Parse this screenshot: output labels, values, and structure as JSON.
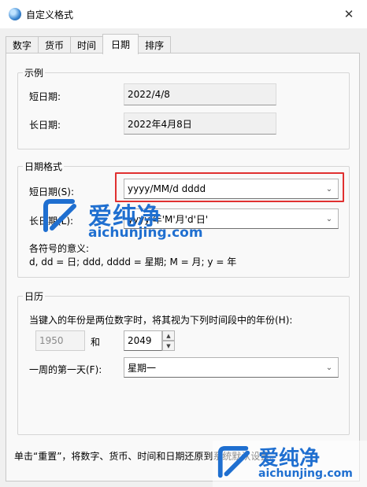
{
  "window": {
    "title": "自定义格式",
    "close_glyph": "✕"
  },
  "tabs": [
    {
      "label": "数字"
    },
    {
      "label": "货币"
    },
    {
      "label": "时间"
    },
    {
      "label": "日期",
      "active": true
    },
    {
      "label": "排序"
    }
  ],
  "example": {
    "group_label": "示例",
    "short_label": "短日期:",
    "short_value": "2022/4/8",
    "long_label": "长日期:",
    "long_value": "2022年4月8日"
  },
  "date_formats": {
    "group_label": "日期格式",
    "short_label": "短日期(S):",
    "short_value": "yyyy/MM/d dddd",
    "long_label": "长日期(L):",
    "long_value": "yyyy'年'M'月'd'日'",
    "legend_title": "各符号的意义:",
    "legend_text": "d, dd = 日;  ddd, dddd = 星期;  M = 月;  y = 年"
  },
  "calendar": {
    "group_label": "日历",
    "two_digit_text": "当键入的年份是两位数字时，将其视为下列时间段中的年份(H):",
    "from_year": "1950",
    "and_label": "和",
    "to_year": "2049",
    "first_day_label": "一周的第一天(F):",
    "first_day_value": "星期一"
  },
  "footer": {
    "text": "单击“重置”，将数字、货币、时间和日期还原到系统默认设置。"
  },
  "watermark": {
    "cn": "爱纯净",
    "en": "aichunjing.com"
  },
  "colors": {
    "highlight": "#e03030",
    "watermark": "#1f6fd0"
  }
}
